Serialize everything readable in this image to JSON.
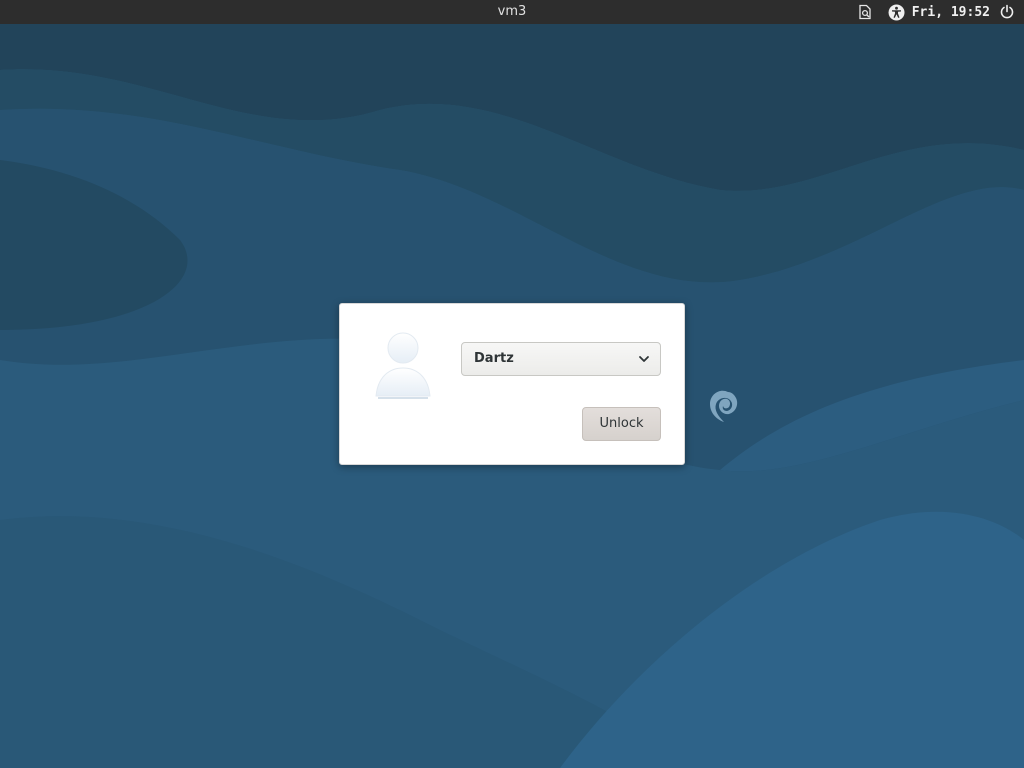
{
  "topbar": {
    "hostname": "vm3",
    "clock": "Fri, 19:52",
    "icons": [
      "document-search-icon",
      "accessibility-icon",
      "power-icon"
    ]
  },
  "wallpaper": {
    "base_color": "#2a5877",
    "logo": "debian-swirl-icon"
  },
  "lock_dialog": {
    "avatar": "user-avatar-icon",
    "user_select": {
      "selected": "Dartz"
    },
    "unlock_label": "Unlock"
  },
  "colors": {
    "topbar": "#2d2d2d",
    "dialog_bg": "#ffffff",
    "button_bg": "#dcd7d3"
  }
}
